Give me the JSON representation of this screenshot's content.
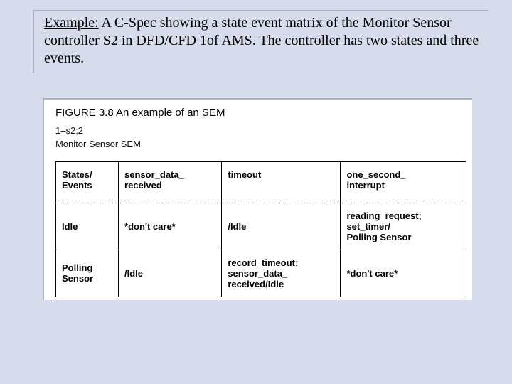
{
  "intro": {
    "prefix": "Example:",
    "text": " A C-Spec showing a state event matrix of the Monitor Sensor controller S2 in DFD/CFD 1of AMS. The controller has two states and three events."
  },
  "figure": {
    "caption": "FIGURE 3.8  An example of an SEM",
    "meta_line1": "1–s2;2",
    "meta_line2": "Monitor Sensor SEM",
    "headers": {
      "col0": "States/\nEvents",
      "col1": "sensor_data_\nreceived",
      "col2": "timeout",
      "col3": "one_second_\ninterrupt"
    },
    "rows": [
      {
        "state": "Idle",
        "c1": "*don't care*",
        "c2": "/Idle",
        "c3": "reading_request;\nset_timer/\nPolling Sensor"
      },
      {
        "state": "Polling\nSensor",
        "c1": "/Idle",
        "c2": "record_timeout;\nsensor_data_\nreceived/Idle",
        "c3": "*don't care*"
      }
    ]
  }
}
